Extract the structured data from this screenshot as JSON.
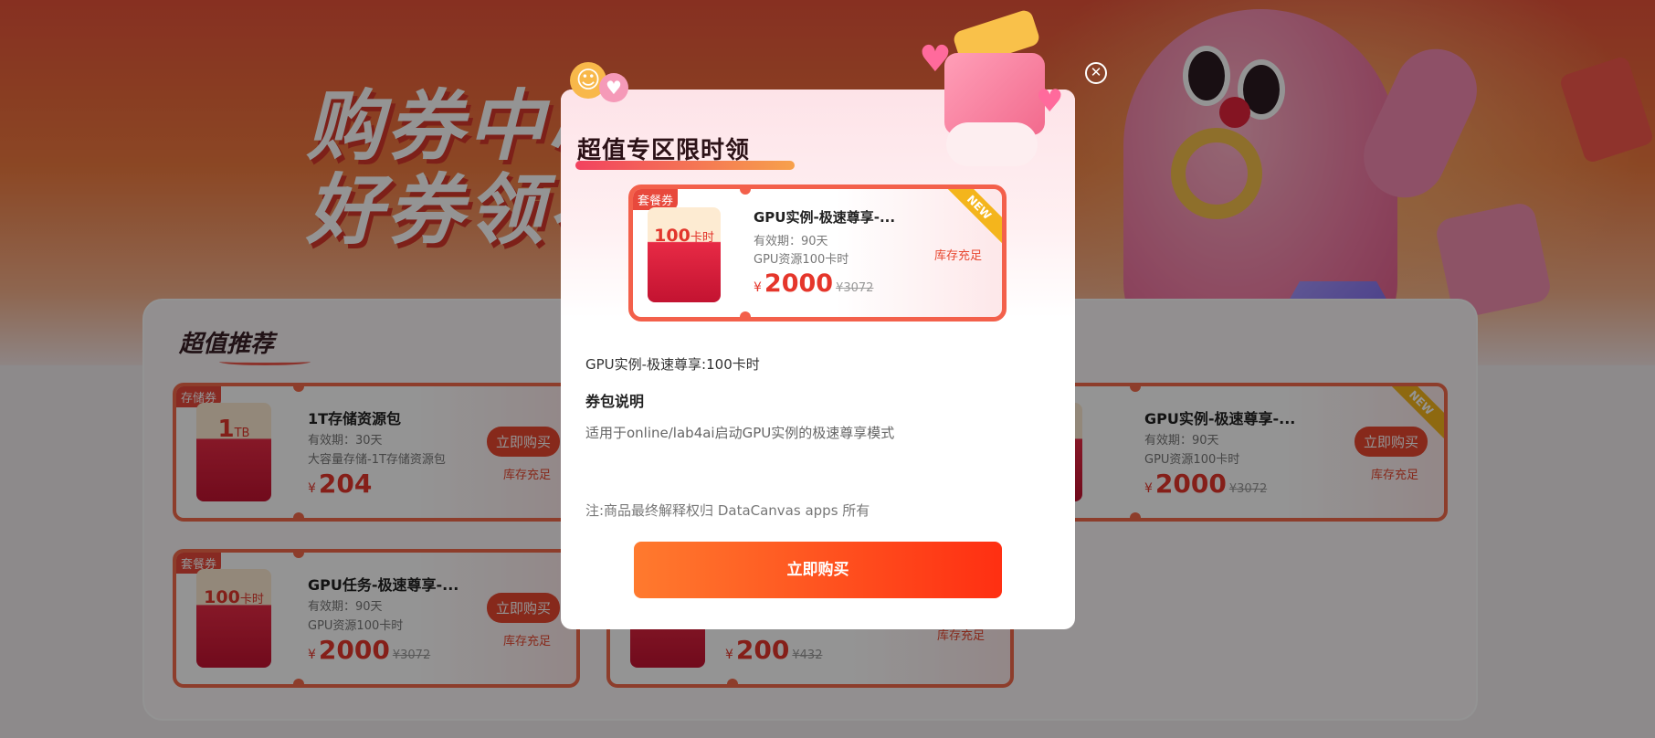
{
  "hero": {
    "title_line1": "购券中心",
    "title_line2": "好券领不停"
  },
  "recommend": {
    "title": "超值推荐",
    "coupons": [
      {
        "tag": "存储券",
        "env_value": "1",
        "env_unit": "TB",
        "name": "1T存储资源包",
        "validity": "有效期：30天",
        "desc": "大容量存储-1T存储资源包",
        "currency": "¥",
        "price": "204",
        "original": "",
        "buy_label": "立即购买",
        "stock": "库存充足"
      },
      {
        "tag": "套餐券",
        "env_value": "100",
        "env_unit": "卡时",
        "name": "GPU实例-极速尊享-...",
        "validity": "有效期：90天",
        "desc": "GPU资源100卡时",
        "currency": "¥",
        "price": "2000",
        "original": "¥3072",
        "buy_label": "立即购买",
        "stock": "库存充足",
        "badge": "NEW"
      },
      {
        "tag": "套餐券",
        "env_value": "100",
        "env_unit": "卡时",
        "name": "GPU任务-极速尊享-...",
        "validity": "有效期：90天",
        "desc": "GPU资源100卡时",
        "currency": "¥",
        "price": "2000",
        "original": "¥3072",
        "buy_label": "立即购买",
        "stock": "库存充足"
      },
      {
        "tag": "",
        "env_value": "",
        "env_unit": "",
        "name": "",
        "validity": "",
        "desc": "",
        "currency": "¥",
        "price": "200",
        "original": "¥432",
        "buy_label": "",
        "stock": "库存充足"
      }
    ]
  },
  "modal": {
    "title": "超值专区限时领",
    "close_icon": "close-icon",
    "coupon": {
      "tag": "套餐券",
      "env_value": "100",
      "env_unit": "卡时",
      "name": "GPU实例-极速尊享-...",
      "validity": "有效期：90天",
      "desc": "GPU资源100卡时",
      "currency": "¥",
      "price": "2000",
      "original": "¥3072",
      "stock": "库存充足",
      "badge": "NEW"
    },
    "product_name": "GPU实例-极速尊享:100卡时",
    "section_title": "券包说明",
    "description": "适用于online/lab4ai启动GPU实例的极速尊享模式",
    "note": "注:商品最终解释权归 DataCanvas apps 所有",
    "buy_label": "立即购买"
  },
  "colors": {
    "accent": "#ff3a17",
    "coupon_border": "#f3604b",
    "stock_text": "#e8472f",
    "badge": "#f4b51c"
  }
}
